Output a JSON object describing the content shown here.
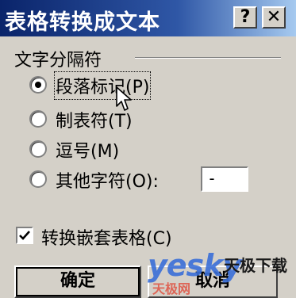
{
  "dialog": {
    "title": "表格转换成文本",
    "help_glyph": "?",
    "close_glyph": "✕"
  },
  "separator_group": {
    "label": "文字分隔符",
    "selected": "paragraph",
    "options": [
      {
        "key": "paragraph",
        "label": "段落标记(P)"
      },
      {
        "key": "tab",
        "label": "制表符(T)"
      },
      {
        "key": "comma",
        "label": "逗号(M)"
      },
      {
        "key": "other",
        "label": "其他字符(O):"
      }
    ],
    "other_value": "-"
  },
  "nested_tables": {
    "label": "转换嵌套表格(C)",
    "checked": true
  },
  "buttons": {
    "ok": "确定",
    "cancel": "取消"
  },
  "watermark": {
    "brand": "yesky",
    "brand_cn": "天极下载",
    "sub": "天极网"
  },
  "colors": {
    "title_bar": "#0a246a",
    "face": "#d4d0c8"
  }
}
